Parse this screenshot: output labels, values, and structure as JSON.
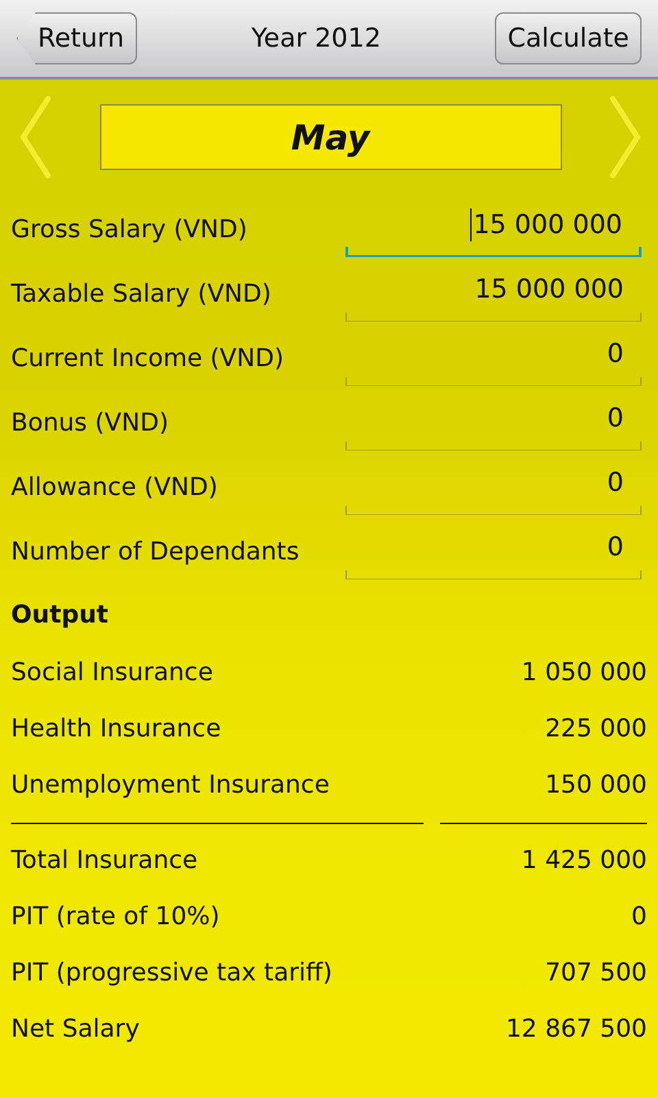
{
  "header": {
    "back_button": "Return",
    "title": "Year 2012",
    "action_button": "Calculate"
  },
  "month": {
    "label": "May"
  },
  "inputs": [
    {
      "label": "Gross Salary (VND)",
      "value": "15 000 000",
      "focused": true
    },
    {
      "label": "Taxable Salary (VND)",
      "value": "15 000 000",
      "focused": false
    },
    {
      "label": "Current Income (VND)",
      "value": "0",
      "focused": false
    },
    {
      "label": "Bonus (VND)",
      "value": "0",
      "focused": false
    },
    {
      "label": "Allowance (VND)",
      "value": "0",
      "focused": false
    },
    {
      "label": "Number of Dependants",
      "value": "0",
      "focused": false
    }
  ],
  "output": {
    "heading": "Output",
    "rows": [
      {
        "kind": "row",
        "label": "Social Insurance",
        "value": "1 050 000"
      },
      {
        "kind": "row",
        "label": "Health Insurance",
        "value": "225 000"
      },
      {
        "kind": "row",
        "label": "Unemployment Insurance",
        "value": "150 000"
      },
      {
        "kind": "divider"
      },
      {
        "kind": "row",
        "label": "Total Insurance",
        "value": "1 425 000"
      },
      {
        "kind": "row",
        "label": "PIT (rate of 10%)",
        "value": "0"
      },
      {
        "kind": "row",
        "label": "PIT (progressive tax tariff)",
        "value": "707 500"
      },
      {
        "kind": "row",
        "label": "Net Salary",
        "value": "12 867 500"
      }
    ]
  }
}
